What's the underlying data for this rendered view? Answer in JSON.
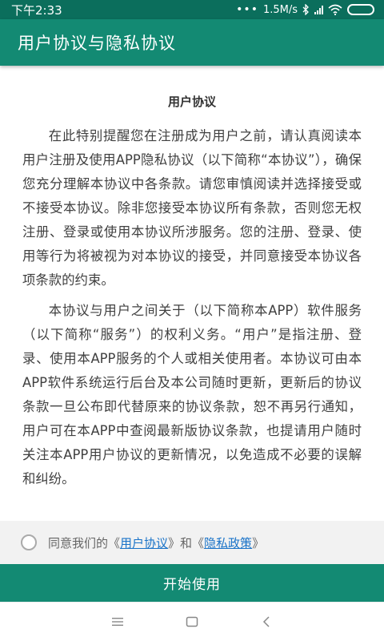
{
  "status_bar": {
    "time": "下午2:33",
    "dots": "•••",
    "speed": "1.5M/s"
  },
  "app_bar": {
    "title": "用户协议与隐私协议"
  },
  "document": {
    "title": "用户协议",
    "paragraphs": [
      "在此特别提醒您在注册成为用户之前，请认真阅读本用户注册及使用APP隐私协议（以下简称“本协议”），确保您充分理解本协议中各条款。请您审慎阅读并选择接受或不接受本协议。除非您接受本协议所有条款，否则您无权注册、登录或使用本协议所涉服务。您的注册、登录、使用等行为将被视为对本协议的接受，并同意接受本协议各项条款的约束。",
      "本协议与用户之间关于（以下简称本APP）软件服务（以下简称“服务”）的权利义务。“用户”是指注册、登录、使用本APP服务的个人或相关使用者。本协议可由本APP软件系统运行后台及本公司随时更新，更新后的协议条款一旦公布即代替原来的协议条款，恕不再另行通知，用户可在本APP中查阅最新版协议条款，也提请用户随时关注本APP用户协议的更新情况，以免造成不必要的误解和纠纷。"
    ]
  },
  "agree": {
    "prefix": "同意我们的《",
    "user_agreement": "用户协议",
    "middle": "》和《",
    "privacy_policy": "隐私政策",
    "suffix": "》"
  },
  "start_button": {
    "label": "开始使用"
  },
  "colors": {
    "status_bar": "#0b6e5c",
    "primary": "#138a73",
    "link": "#1a73c8"
  }
}
